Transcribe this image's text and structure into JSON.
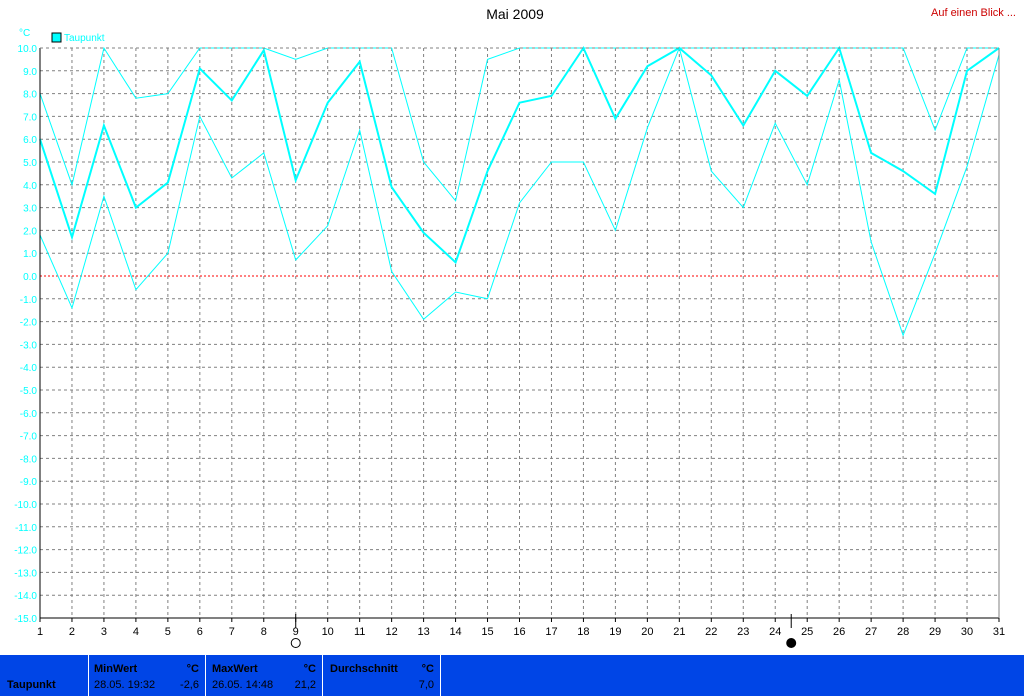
{
  "header": {
    "title": "Mai 2009",
    "link": "Auf einen Blick ..."
  },
  "chart_data": {
    "type": "line",
    "unit": "°C",
    "ylim": [
      -15,
      10
    ],
    "ytick_step": 1,
    "x": [
      1,
      2,
      3,
      4,
      5,
      6,
      7,
      8,
      9,
      10,
      11,
      12,
      13,
      14,
      15,
      16,
      17,
      18,
      19,
      20,
      21,
      22,
      23,
      24,
      25,
      26,
      27,
      28,
      29,
      30,
      31
    ],
    "legend": [
      "Taupunkt"
    ],
    "legend_position": "top-left",
    "grid": true,
    "colors": {
      "series": "#00ffff",
      "zero_line": "#ff0000",
      "axis": "#000000",
      "grid": "#808080",
      "tick_text": "#00ffff"
    },
    "series": [
      {
        "name": "Taupunkt",
        "role": "avg",
        "values": [
          6.0,
          1.7,
          6.6,
          3.0,
          4.1,
          9.1,
          7.7,
          9.9,
          4.2,
          7.6,
          9.4,
          3.9,
          1.9,
          0.6,
          4.6,
          7.6,
          7.9,
          10.0,
          6.9,
          9.2,
          10.0,
          8.8,
          6.6,
          9.0,
          7.9,
          10.0,
          5.4,
          4.6,
          3.6,
          9.0,
          10.0
        ]
      },
      {
        "name": "",
        "role": "max",
        "values": [
          8.0,
          4.0,
          10.0,
          7.8,
          8.0,
          10.0,
          10.0,
          10.0,
          9.5,
          10.0,
          10.0,
          10.0,
          5.0,
          3.3,
          9.5,
          10.0,
          10.0,
          10.0,
          10.0,
          10.0,
          10.0,
          10.0,
          10.0,
          10.0,
          10.0,
          10.0,
          10.0,
          10.0,
          6.4,
          10.0,
          10.0
        ]
      },
      {
        "name": "",
        "role": "min",
        "values": [
          1.8,
          -1.4,
          3.5,
          -0.6,
          1.0,
          7.0,
          4.3,
          5.4,
          0.7,
          2.2,
          6.4,
          0.2,
          -1.9,
          -0.7,
          -1.0,
          3.2,
          5.0,
          5.0,
          2.0,
          6.5,
          10.0,
          4.6,
          3.0,
          6.7,
          4.0,
          8.6,
          1.5,
          -2.6,
          1.0,
          4.8,
          9.7
        ]
      }
    ],
    "moon_phases": [
      {
        "day": 9,
        "phase": "full-moon"
      },
      {
        "day": 24.5,
        "phase": "new-moon"
      }
    ]
  },
  "footer": {
    "series_label": "Taupunkt",
    "min": {
      "label": "MinWert",
      "unit": "°C",
      "datetime": "28.05. 19:32",
      "value": "-2,6"
    },
    "max": {
      "label": "MaxWert",
      "unit": "°C",
      "datetime": "26.05. 14:48",
      "value": "21,2"
    },
    "avg": {
      "label": "Durchschnitt",
      "unit": "°C",
      "value": "7,0"
    }
  }
}
